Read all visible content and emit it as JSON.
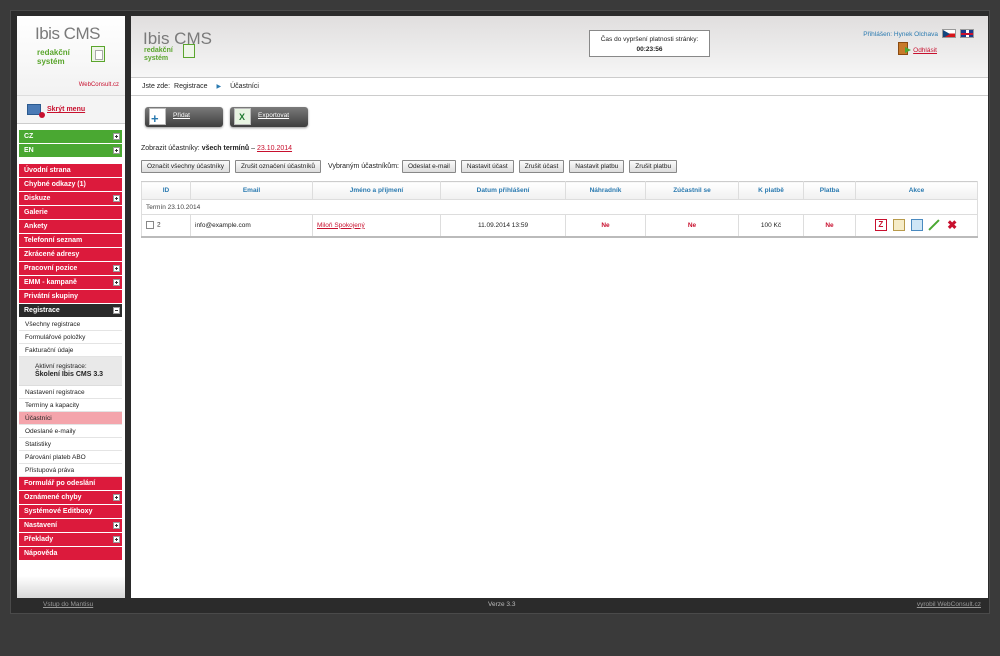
{
  "sidebar": {
    "logo_title": "Ibis CMS",
    "logo_sub1": "redakční",
    "logo_sub2": "systém",
    "brand": "WebConsult.cz",
    "hide_menu": "Skrýt menu",
    "lang": [
      {
        "label": "CZ"
      },
      {
        "label": "EN"
      }
    ],
    "items": [
      {
        "label": "Úvodní strana"
      },
      {
        "label": "Chybné odkazy (1)"
      },
      {
        "label": "Diskuze"
      },
      {
        "label": "Galerie"
      },
      {
        "label": "Ankety"
      },
      {
        "label": "Telefonní seznam"
      },
      {
        "label": "Zkrácené adresy"
      },
      {
        "label": "Pracovní pozice"
      },
      {
        "label": "EMM - kampaně"
      },
      {
        "label": "Privátní skupiny"
      },
      {
        "label": "Registrace"
      }
    ],
    "sub_items": [
      {
        "label": "Všechny registrace"
      },
      {
        "label": "Formulářové položky"
      },
      {
        "label": "Fakturační údaje"
      }
    ],
    "active_reg_label": "Aktivní registrace:",
    "active_reg_value": "Školení Ibis CMS 3.3",
    "sub_items2": [
      {
        "label": "Nastavení registrace"
      },
      {
        "label": "Termíny a kapacity"
      },
      {
        "label": "Účastníci"
      },
      {
        "label": "Odeslané e-maily"
      },
      {
        "label": "Statistiky"
      },
      {
        "label": "Párování plateb ABO"
      },
      {
        "label": "Přístupová práva"
      }
    ],
    "items2": [
      {
        "label": "Formulář po odeslání"
      },
      {
        "label": "Oznámené chyby"
      },
      {
        "label": "Systémové Editboxy"
      },
      {
        "label": "Nastavení"
      },
      {
        "label": "Překlady"
      },
      {
        "label": "Nápověda"
      }
    ]
  },
  "header": {
    "logo_title": "Ibis CMS",
    "logo_sub1": "redakční",
    "logo_sub2": "systém",
    "timer_label": "Čas do vypršení platnosti stránky:",
    "timer_value": "00:23:56",
    "user": "Přihlášen: Hynek Olchava",
    "logout": "Odhlásit"
  },
  "breadcrumb": {
    "prefix": "Jste zde:",
    "item1": "Registrace",
    "item2": "Účastníci"
  },
  "toolbar": {
    "add": "Přidat",
    "export": "Exportovat"
  },
  "filter": {
    "prefix": "Zobrazit účastníky:",
    "bold": "všech termínů",
    "dash": "–",
    "link": "23.10.2014"
  },
  "actions": {
    "mark_all": "Označit všechny účastníky",
    "unmark_all": "Zrušit označení účastníků",
    "label": "Vybraným účastníkům:",
    "send_email": "Odeslat e-mail",
    "set_attendance": "Nastavit účast",
    "cancel_attendance": "Zrušit účast",
    "set_payment": "Nastavit platbu",
    "cancel_payment": "Zrušit platbu"
  },
  "table": {
    "headers": [
      "ID",
      "Email",
      "Jméno a příjmení",
      "Datum přihlášení",
      "Náhradník",
      "Zúčastnil se",
      "K platbě",
      "Platba",
      "Akce"
    ],
    "group": "Termín 23.10.2014",
    "rows": [
      {
        "id": "2",
        "email": "info@example.com",
        "name": "Miloň Spokojený",
        "date": "11.09.2014 13:59",
        "substitute": "Ne",
        "attended": "Ne",
        "amount": "100 Kč",
        "paid": "Ne"
      }
    ]
  },
  "footer": {
    "left": "Vstup do Mantisu",
    "center": "Verze 3.3",
    "right": "vyrobil WebConsult.cz"
  }
}
